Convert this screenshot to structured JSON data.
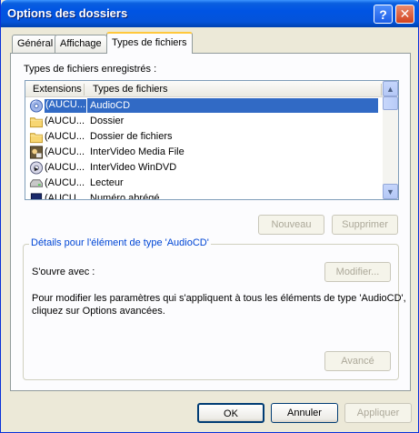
{
  "window": {
    "title": "Options des dossiers",
    "help_icon": "help-icon",
    "close_icon": "close-icon"
  },
  "tabs": [
    {
      "label": "Général",
      "active": false
    },
    {
      "label": "Affichage",
      "active": false
    },
    {
      "label": "Types de fichiers",
      "active": true
    }
  ],
  "registered_label": "Types de fichiers enregistrés :",
  "list": {
    "columns": [
      "Extensions",
      "Types de fichiers"
    ],
    "rows": [
      {
        "ext": "(AUCU...",
        "type": "AudioCD",
        "icon": "audio-cd-icon",
        "selected": true
      },
      {
        "ext": "(AUCU...",
        "type": "Dossier",
        "icon": "folder-icon",
        "selected": false
      },
      {
        "ext": "(AUCU...",
        "type": "Dossier de fichiers",
        "icon": "folder-icon",
        "selected": false
      },
      {
        "ext": "(AUCU...",
        "type": "InterVideo Media File",
        "icon": "media-file-icon",
        "selected": false
      },
      {
        "ext": "(AUCU...",
        "type": "InterVideo WinDVD",
        "icon": "dvd-icon",
        "selected": false
      },
      {
        "ext": "(AUCU...",
        "type": "Lecteur",
        "icon": "drive-icon",
        "selected": false
      },
      {
        "ext": "(AUCU...",
        "type": "Numéro abrégé",
        "icon": "speed-dial-icon",
        "selected": false
      }
    ]
  },
  "buttons": {
    "new": "Nouveau",
    "delete": "Supprimer",
    "modify": "Modifier...",
    "advanced": "Avancé",
    "ok": "OK",
    "cancel": "Annuler",
    "apply": "Appliquer"
  },
  "details": {
    "title": "Détails pour l'élément de type 'AudioCD'",
    "opens_with": "S'ouvre avec :",
    "description_line1": "Pour modifier les paramètres qui s'appliquent à tous les éléments de type 'AudioCD',",
    "description_line2": "cliquez sur Options avancées."
  }
}
